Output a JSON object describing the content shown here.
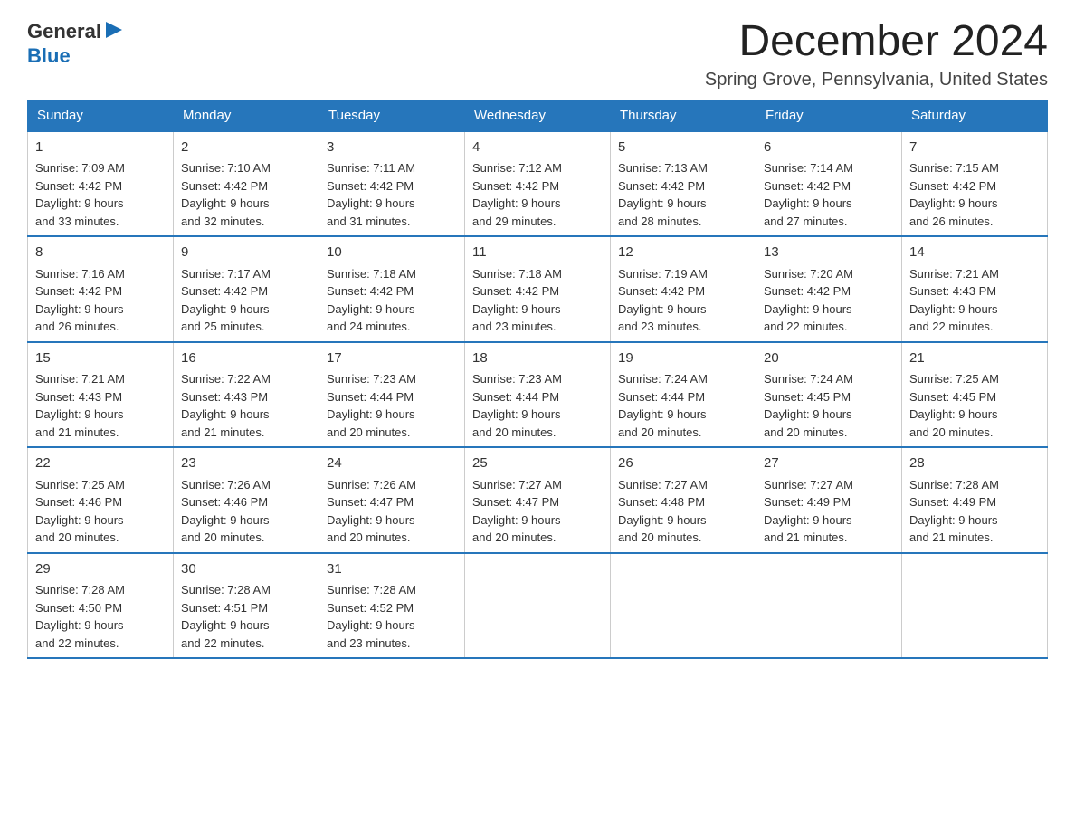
{
  "logo": {
    "general": "General",
    "blue": "Blue"
  },
  "title": "December 2024",
  "location": "Spring Grove, Pennsylvania, United States",
  "weekdays": [
    "Sunday",
    "Monday",
    "Tuesday",
    "Wednesday",
    "Thursday",
    "Friday",
    "Saturday"
  ],
  "weeks": [
    [
      {
        "day": "1",
        "sunrise": "7:09 AM",
        "sunset": "4:42 PM",
        "daylight": "9 hours and 33 minutes."
      },
      {
        "day": "2",
        "sunrise": "7:10 AM",
        "sunset": "4:42 PM",
        "daylight": "9 hours and 32 minutes."
      },
      {
        "day": "3",
        "sunrise": "7:11 AM",
        "sunset": "4:42 PM",
        "daylight": "9 hours and 31 minutes."
      },
      {
        "day": "4",
        "sunrise": "7:12 AM",
        "sunset": "4:42 PM",
        "daylight": "9 hours and 29 minutes."
      },
      {
        "day": "5",
        "sunrise": "7:13 AM",
        "sunset": "4:42 PM",
        "daylight": "9 hours and 28 minutes."
      },
      {
        "day": "6",
        "sunrise": "7:14 AM",
        "sunset": "4:42 PM",
        "daylight": "9 hours and 27 minutes."
      },
      {
        "day": "7",
        "sunrise": "7:15 AM",
        "sunset": "4:42 PM",
        "daylight": "9 hours and 26 minutes."
      }
    ],
    [
      {
        "day": "8",
        "sunrise": "7:16 AM",
        "sunset": "4:42 PM",
        "daylight": "9 hours and 26 minutes."
      },
      {
        "day": "9",
        "sunrise": "7:17 AM",
        "sunset": "4:42 PM",
        "daylight": "9 hours and 25 minutes."
      },
      {
        "day": "10",
        "sunrise": "7:18 AM",
        "sunset": "4:42 PM",
        "daylight": "9 hours and 24 minutes."
      },
      {
        "day": "11",
        "sunrise": "7:18 AM",
        "sunset": "4:42 PM",
        "daylight": "9 hours and 23 minutes."
      },
      {
        "day": "12",
        "sunrise": "7:19 AM",
        "sunset": "4:42 PM",
        "daylight": "9 hours and 23 minutes."
      },
      {
        "day": "13",
        "sunrise": "7:20 AM",
        "sunset": "4:42 PM",
        "daylight": "9 hours and 22 minutes."
      },
      {
        "day": "14",
        "sunrise": "7:21 AM",
        "sunset": "4:43 PM",
        "daylight": "9 hours and 22 minutes."
      }
    ],
    [
      {
        "day": "15",
        "sunrise": "7:21 AM",
        "sunset": "4:43 PM",
        "daylight": "9 hours and 21 minutes."
      },
      {
        "day": "16",
        "sunrise": "7:22 AM",
        "sunset": "4:43 PM",
        "daylight": "9 hours and 21 minutes."
      },
      {
        "day": "17",
        "sunrise": "7:23 AM",
        "sunset": "4:44 PM",
        "daylight": "9 hours and 20 minutes."
      },
      {
        "day": "18",
        "sunrise": "7:23 AM",
        "sunset": "4:44 PM",
        "daylight": "9 hours and 20 minutes."
      },
      {
        "day": "19",
        "sunrise": "7:24 AM",
        "sunset": "4:44 PM",
        "daylight": "9 hours and 20 minutes."
      },
      {
        "day": "20",
        "sunrise": "7:24 AM",
        "sunset": "4:45 PM",
        "daylight": "9 hours and 20 minutes."
      },
      {
        "day": "21",
        "sunrise": "7:25 AM",
        "sunset": "4:45 PM",
        "daylight": "9 hours and 20 minutes."
      }
    ],
    [
      {
        "day": "22",
        "sunrise": "7:25 AM",
        "sunset": "4:46 PM",
        "daylight": "9 hours and 20 minutes."
      },
      {
        "day": "23",
        "sunrise": "7:26 AM",
        "sunset": "4:46 PM",
        "daylight": "9 hours and 20 minutes."
      },
      {
        "day": "24",
        "sunrise": "7:26 AM",
        "sunset": "4:47 PM",
        "daylight": "9 hours and 20 minutes."
      },
      {
        "day": "25",
        "sunrise": "7:27 AM",
        "sunset": "4:47 PM",
        "daylight": "9 hours and 20 minutes."
      },
      {
        "day": "26",
        "sunrise": "7:27 AM",
        "sunset": "4:48 PM",
        "daylight": "9 hours and 20 minutes."
      },
      {
        "day": "27",
        "sunrise": "7:27 AM",
        "sunset": "4:49 PM",
        "daylight": "9 hours and 21 minutes."
      },
      {
        "day": "28",
        "sunrise": "7:28 AM",
        "sunset": "4:49 PM",
        "daylight": "9 hours and 21 minutes."
      }
    ],
    [
      {
        "day": "29",
        "sunrise": "7:28 AM",
        "sunset": "4:50 PM",
        "daylight": "9 hours and 22 minutes."
      },
      {
        "day": "30",
        "sunrise": "7:28 AM",
        "sunset": "4:51 PM",
        "daylight": "9 hours and 22 minutes."
      },
      {
        "day": "31",
        "sunrise": "7:28 AM",
        "sunset": "4:52 PM",
        "daylight": "9 hours and 23 minutes."
      },
      null,
      null,
      null,
      null
    ]
  ]
}
